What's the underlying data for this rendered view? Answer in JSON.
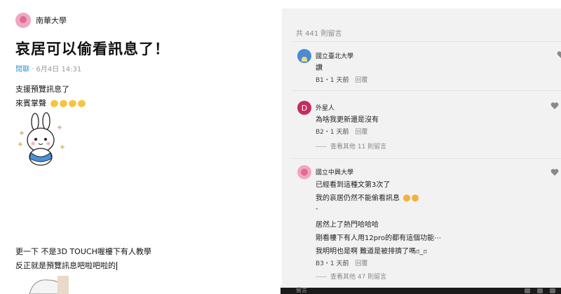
{
  "post": {
    "board": "南華大學",
    "title": "哀居可以偷看訊息了！",
    "category": "閒聊",
    "date": "6月4日 14:31",
    "lines": [
      "支援預覽訊息了",
      "來賓掌聲"
    ],
    "update_lines": [
      "更一下 不是3D TOUCH喔樓下有人教學",
      "反正就是預覽訊息吧啦吧啦的"
    ]
  },
  "comments": {
    "count_label": "共 441 則留言",
    "items": [
      {
        "author": "國立臺北大學",
        "avatar": "school-avatar",
        "lines": [
          "讚"
        ],
        "floor": "B1・1 天前",
        "reply_label": "回覆"
      },
      {
        "author": "外星人",
        "avatar_letter": "D",
        "lines": [
          "為啥我更新還是沒有"
        ],
        "floor": "B2・1 天前",
        "reply_label": "回覆",
        "more_label": "查看其他 11 則留言"
      },
      {
        "author": "國立中興大學",
        "avatar": "school-avatar",
        "lines": [
          "已經看到這種文第3次了",
          "我的哀居仍然不能偷看訊息",
          "-",
          "居然上了熱門哈哈哈",
          "剛看樓下有人用12pro的都有這個功能⋯",
          "我明明也是啊 難道是被排擠了嗎ರ_ರ"
        ],
        "floor": "B3・1 天前",
        "reply_label": "回覆",
        "more_label": "查看其他 47 則留言"
      }
    ]
  },
  "bottom": {
    "label": "留言"
  },
  "colors": {
    "link": "#3397cf",
    "accent_pink": "#e06b93",
    "letter_avatar": "#c32d5d"
  }
}
